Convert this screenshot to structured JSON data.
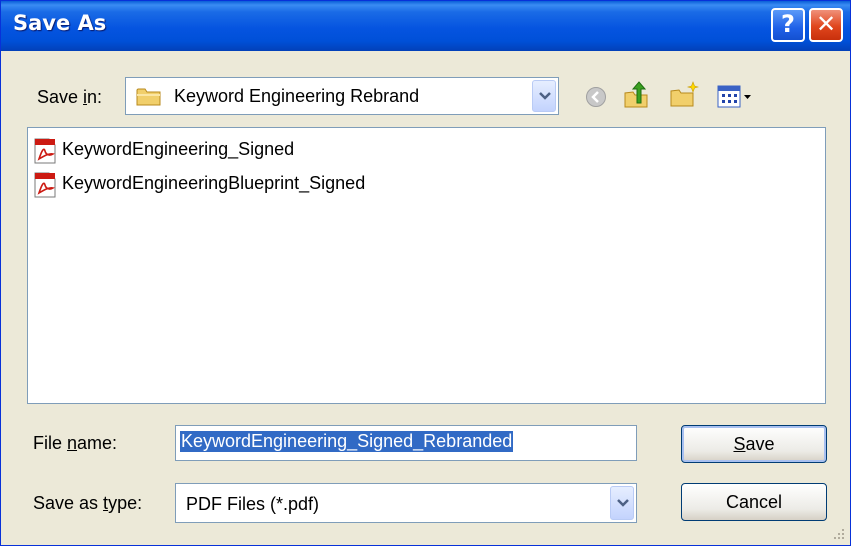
{
  "window": {
    "title": "Save As"
  },
  "titlebar": {
    "help_glyph": "?",
    "close_glyph": "✕"
  },
  "save_in": {
    "label_before": "Save ",
    "label_accel": "i",
    "label_after": "n:",
    "folder": "Keyword Engineering Rebrand"
  },
  "toolbar_icons": [
    "back-icon",
    "up-folder-icon",
    "new-folder-icon",
    "views-menu-icon"
  ],
  "files": [
    {
      "name": "KeywordEngineering_Signed",
      "icon": "pdf-icon"
    },
    {
      "name": "KeywordEngineeringBlueprint_Signed",
      "icon": "pdf-icon"
    }
  ],
  "file_name": {
    "label_before": "File ",
    "label_accel": "n",
    "label_after": "ame:",
    "value": "KeywordEngineering_Signed_Rebranded"
  },
  "save_type": {
    "label_before": "Save as ",
    "label_accel": "t",
    "label_after": "ype:",
    "value": "PDF Files (*.pdf)"
  },
  "buttons": {
    "save_accel": "S",
    "save_rest": "ave",
    "cancel": "Cancel"
  },
  "colors": {
    "titlebar": "#0054e3",
    "selection": "#316ac5",
    "dialog_bg": "#ece9d8"
  }
}
